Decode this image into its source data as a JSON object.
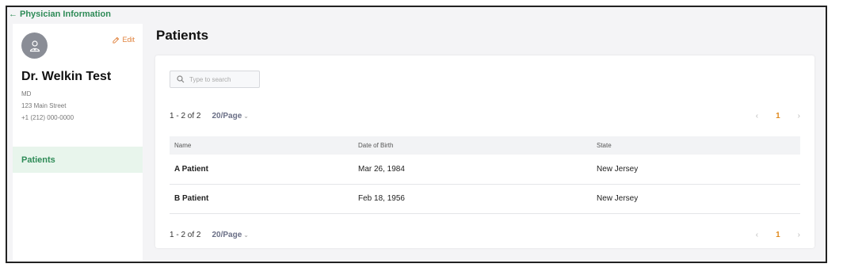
{
  "back_link": {
    "label": "Physician Information"
  },
  "physician": {
    "edit_label": "Edit",
    "name": "Dr. Welkin Test",
    "title": "MD",
    "address": "123 Main Street",
    "phone": "+1 (212) 000-0000"
  },
  "sidebar": {
    "items": [
      {
        "label": "Patients"
      }
    ]
  },
  "page": {
    "title": "Patients"
  },
  "search": {
    "placeholder": "Type to search"
  },
  "pagination": {
    "range": "1 - 2 of 2",
    "per_page": "20/Page",
    "current_page": "1"
  },
  "table": {
    "columns": [
      "Name",
      "Date of Birth",
      "State"
    ],
    "rows": [
      {
        "name": "A Patient",
        "dob": "Mar 26, 1984",
        "state": "New Jersey"
      },
      {
        "name": "B Patient",
        "dob": "Feb 18, 1956",
        "state": "New Jersey"
      }
    ]
  },
  "colors": {
    "accent_green": "#2e8b57",
    "accent_orange": "#e08a1e",
    "edit_orange": "#e0803a"
  }
}
